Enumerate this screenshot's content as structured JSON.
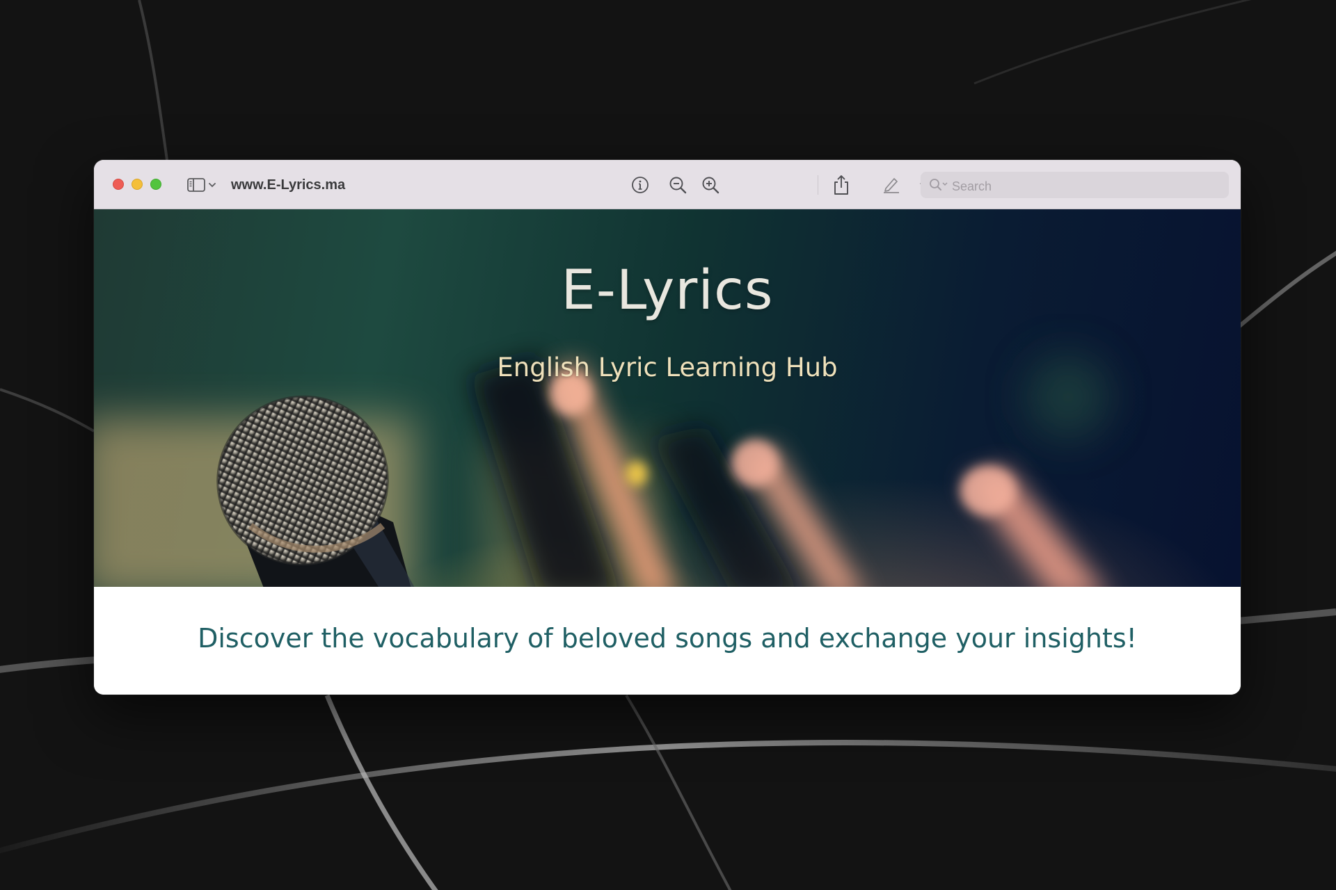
{
  "browser": {
    "url": "www.E-Lyrics.ma",
    "search_placeholder": "Search"
  },
  "hero": {
    "title": "E-Lyrics",
    "subtitle": "English Lyric Learning Hub"
  },
  "main": {
    "tagline": "Discover the vocabulary of beloved songs and exchange your insights!"
  },
  "colors": {
    "tagline": "#1f5f64",
    "toolbar": "#e5e0e6",
    "close": "#ee5c55",
    "minimize": "#f4bf3a",
    "zoom": "#52c43e"
  },
  "icons": {
    "toolbar": [
      "sidebar-icon",
      "chevron-down-icon",
      "info-icon",
      "zoom-out-icon",
      "zoom-in-icon",
      "share-icon",
      "highlighter-icon",
      "chevron-down-icon",
      "rotate-icon",
      "markup-icon",
      "search-icon"
    ]
  }
}
